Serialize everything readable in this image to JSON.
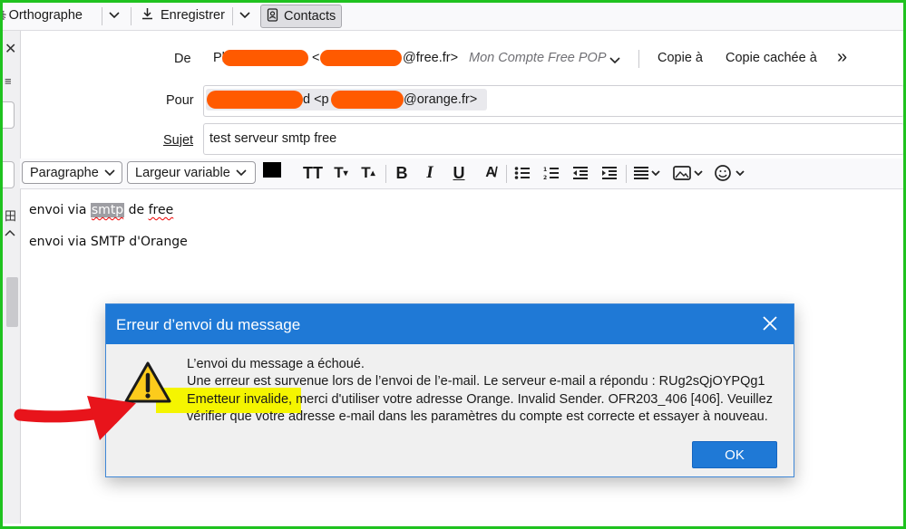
{
  "toolbar": {
    "spell_label": "Orthographe",
    "save_label": "Enregistrer",
    "contacts_label": "Contacts"
  },
  "header": {
    "from_label": "De",
    "from_name_visible": "Pl",
    "from_addr_open": "<",
    "from_domain": "@free.fr>",
    "from_account": "Mon Compte Free POP",
    "cc_label": "Copie à",
    "bcc_label": "Copie cachée à",
    "more_label": "»",
    "to_label": "Pour",
    "to_name_tail": "d <p",
    "to_domain": "@orange.fr>",
    "subject_label": "Sujet",
    "subject_value": "test serveur smtp free",
    "redaction_color": "#ff5a00"
  },
  "format": {
    "paragraph": "Paragraphe",
    "font": "Largeur variable"
  },
  "body": {
    "line1_a": "envoi via ",
    "line1_hl": "smtp",
    "line1_b": " de ",
    "line1_c": "free",
    "line2": "envoi via SMTP d'Orange"
  },
  "dialog": {
    "title": "Erreur d’envoi du message",
    "line1": "L’envoi du message a échoué.",
    "line2": "Une erreur est survenue lors de l’envoi de l’e-mail. Le serveur e-mail a répondu : RUg2sQjOYPQg1",
    "line3": "Emetteur invalide, merci d'utiliser votre adresse Orange. Invalid Sender. OFR203_406 [406]. Veuillez",
    "line4": "vérifier que votre adresse e-mail dans les paramètres du compte est correcte et essayer à nouveau.",
    "ok_label": "OK",
    "accent": "#1f79d6",
    "highlight": "#f5f500"
  },
  "annotation": {
    "arrow_color": "#e8141b",
    "frame_color": "#1fc21f"
  }
}
